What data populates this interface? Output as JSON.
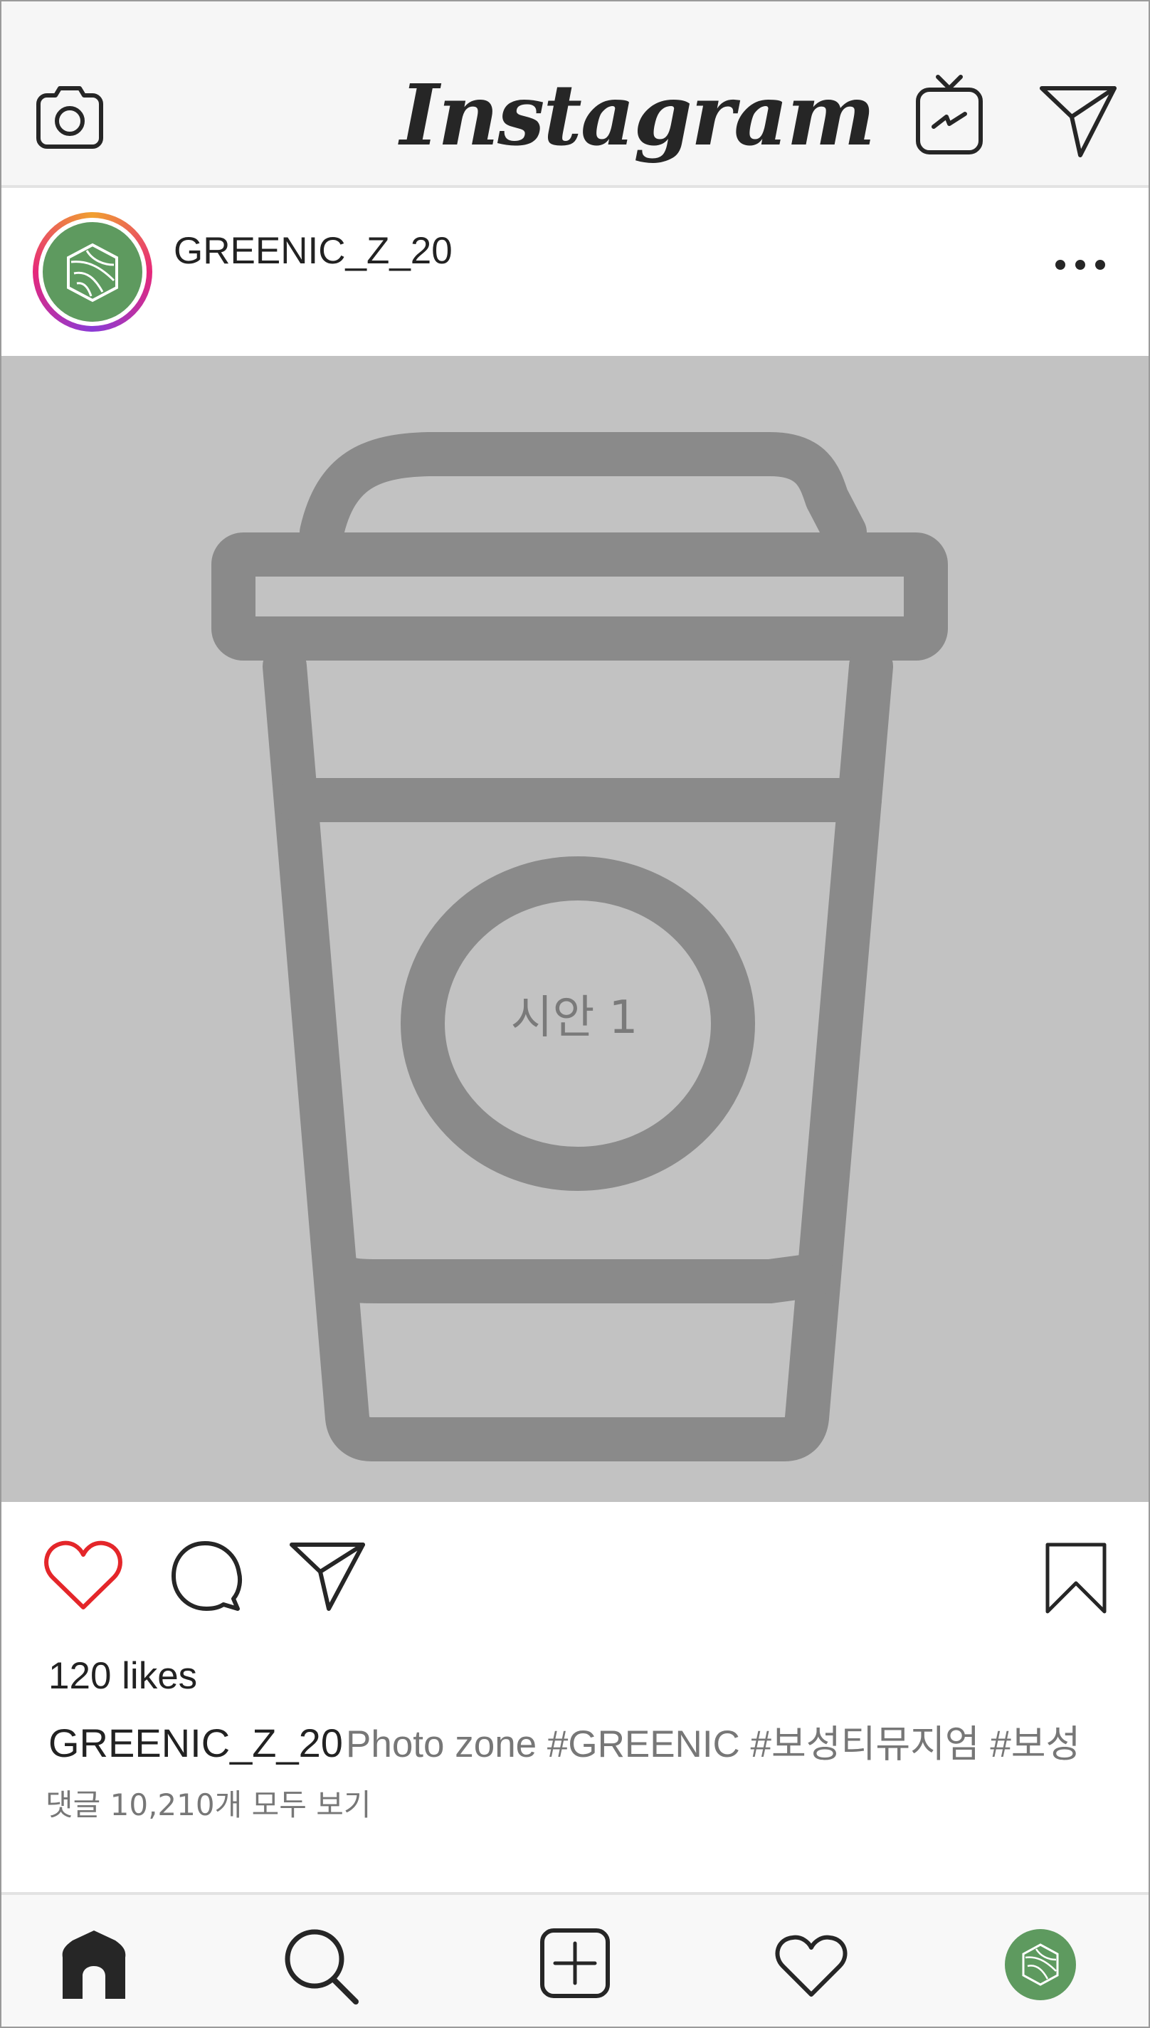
{
  "app": {
    "title": "Instagram"
  },
  "header": {
    "camera_icon": "camera-icon",
    "igtv_icon": "tv-icon",
    "direct_icon": "paper-plane-icon"
  },
  "post": {
    "username": "GREENIC_Z_20",
    "more_icon": "more-horizontal-icon",
    "media_label": "시안 1",
    "likes": "120 likes",
    "caption_user": "GREENIC_Z_20",
    "caption_text": "Photo zone #GREENIC #보성티뮤지엄 #보성",
    "view_comments": "댓글 10,210개 모두 보기"
  },
  "actions": [
    "heart-icon",
    "comment-icon",
    "share-icon",
    "bookmark-icon"
  ],
  "bottom_nav": [
    "home-icon",
    "search-icon",
    "add-icon",
    "activity-icon",
    "profile-avatar"
  ],
  "colors": {
    "like": "#e4262a",
    "avatar_green": "#5e9a5f",
    "media_bg": "#c2c2c2",
    "cup_gray": "#8a8a8a",
    "bar_bg": "#f6f6f6"
  }
}
